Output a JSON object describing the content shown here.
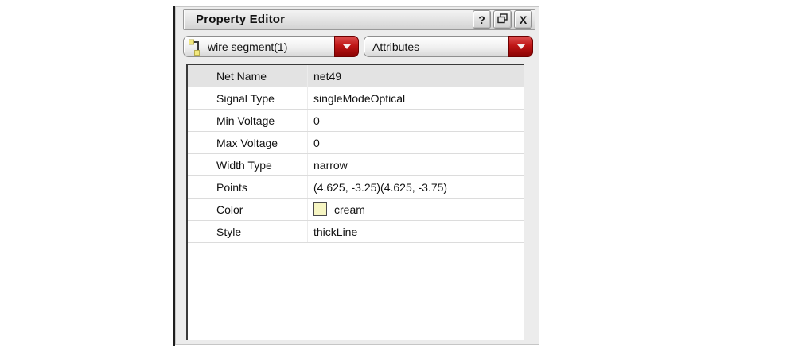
{
  "panel": {
    "title": "Property Editor",
    "buttons": {
      "help": "?",
      "close": "X"
    }
  },
  "selectors": {
    "object_label": "wire segment(1)",
    "view_label": "Attributes"
  },
  "properties": {
    "rows": [
      {
        "label": "Net Name",
        "value": "net49"
      },
      {
        "label": "Signal Type",
        "value": "singleModeOptical"
      },
      {
        "label": "Min Voltage",
        "value": "0"
      },
      {
        "label": "Max Voltage",
        "value": "0"
      },
      {
        "label": "Width Type",
        "value": "narrow"
      },
      {
        "label": "Points",
        "value": "(4.625, -3.25)(4.625, -3.75)"
      },
      {
        "label": "Color",
        "value": "cream",
        "swatch": "#f6f5c2"
      },
      {
        "label": "Style",
        "value": "thickLine"
      }
    ]
  },
  "colors": {
    "accent_red": "#b01010",
    "swatch_cream": "#f6f5c2",
    "table_frame": "#3a3a3a"
  }
}
